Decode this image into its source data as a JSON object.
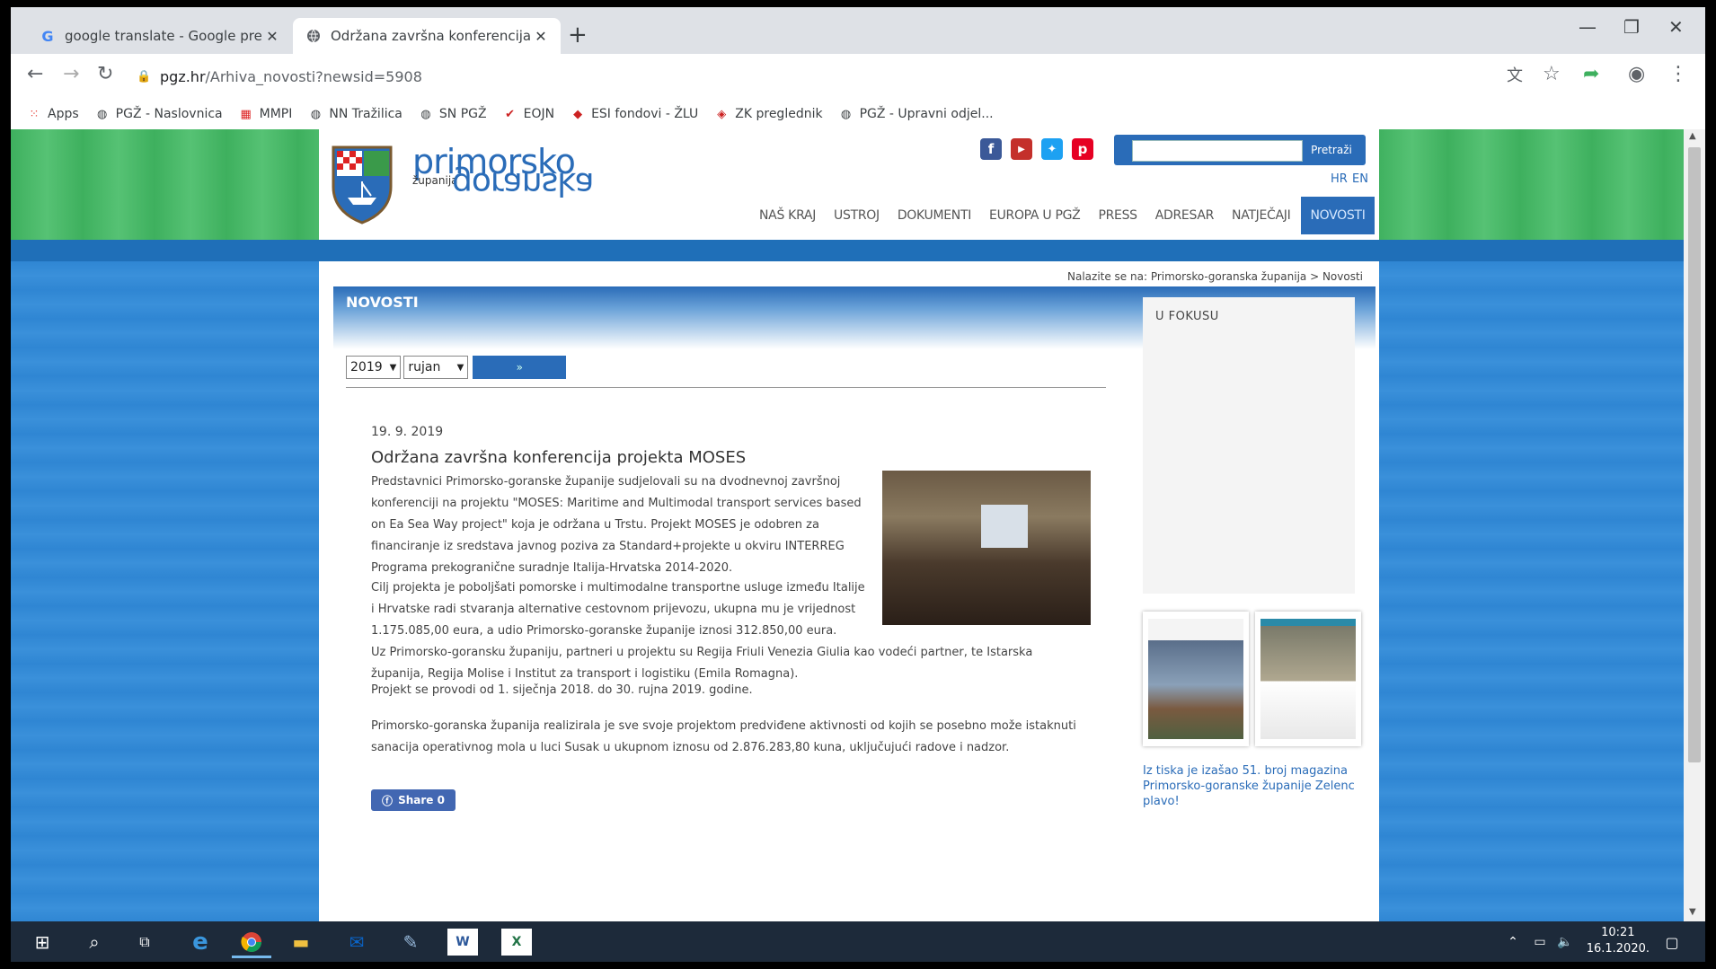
{
  "browser": {
    "tabs": [
      {
        "label": "google translate - Google pretra",
        "favicon": "G"
      },
      {
        "label": "Održana završna konferencija pr",
        "favicon": "globe"
      }
    ],
    "new_tab": "+",
    "address_host": "pgz.hr",
    "address_path": "/Arhiva_novosti?newsid=5908",
    "bookmarks": [
      "Apps",
      "PGŽ - Naslovnica",
      "MMPI",
      "NN Tražilica",
      "SN PGŽ",
      "EOJN",
      "ESI fondovi - ŽLU",
      "ZK preglednik",
      "PGŽ - Upravni odjel..."
    ]
  },
  "header": {
    "logo_line1": "primorsko",
    "logo_line2": "županija",
    "logo_line3": "goranska",
    "search_button": "Pretraži",
    "lang_hr": "HR",
    "lang_en": "EN",
    "menu": [
      "NAŠ KRAJ",
      "USTROJ",
      "DOKUMENTI",
      "EUROPA U PGŽ",
      "PRESS",
      "ADRESAR",
      "NATJEČAJI",
      "NOVOSTI"
    ]
  },
  "breadcrumb": "Nalazite se na: Primorsko-goranska županija > Novosti",
  "panel": {
    "title": "NOVOSTI",
    "year": "2019",
    "month": "rujan",
    "go": "»"
  },
  "article": {
    "date": "19. 9. 2019",
    "title": "Održana završna konferencija projekta MOSES",
    "p1": [
      "Predstavnici Primorsko-goranske županije sudjelovali su na dvodnevnoj završnoj",
      "konferenciji na projektu \"MOSES: Maritime and Multimodal transport services based",
      "on Ea Sea Way project\" koja je održana u Trstu. Projekt MOSES je odobren za",
      "financiranje iz sredstava javnog poziva za Standard+projekte u okviru INTERREG",
      "Programa prekogranične suradnje Italija-Hrvatska 2014-2020."
    ],
    "p2": [
      "Cilj projekta je poboljšati pomorske i multimodalne transportne usluge između Italije",
      "i Hrvatske radi stvaranja alternative cestovnom prijevozu, ukupna mu je vrijednost",
      "1.175.085,00 eura, a  udio Primorsko-goranske županije iznosi 312.850,00 eura.",
      "Uz Primorsko-goransku županiju, partneri u projektu su Regija Friuli Venezia Giulia kao vodeći partner, te Istarska",
      "županija, Regija Molise i Institut za transport i logistiku (Emila Romagna)."
    ],
    "p3": "Projekt se provodi od 1. siječnja 2018. do 30. rujna 2019. godine.",
    "p4": [
      "Primorsko-goranska županija realizirala je sve svoje projektom predviđene aktivnosti od kojih se posebno može istaknuti",
      "sanacija operativnog mola u luci Susak u ukupnom iznosu od 2.876.283,80 kuna, uključujući radove i nadzor."
    ],
    "share": "Share 0"
  },
  "sidebar": {
    "title": "U FOKUSU",
    "caption": [
      "Iz tiska je izašao 51. broj magazina",
      "Primorsko-goranske županije Zelenc",
      "plavo!"
    ]
  },
  "taskbar": {
    "time": "10:21",
    "date": "16.1.2020."
  },
  "colors": {
    "brand_blue": "#2a6cb8",
    "green": "#3eb05e"
  }
}
